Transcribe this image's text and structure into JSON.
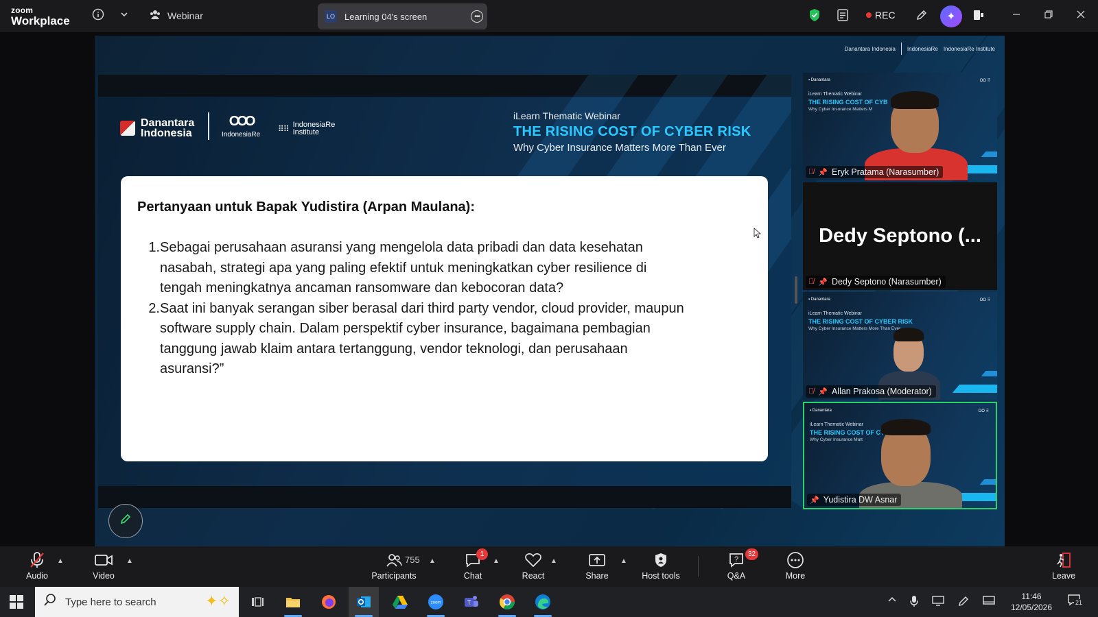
{
  "window": {
    "brand_top": "zoom",
    "brand_bottom": "Workplace",
    "meeting_type": "Webinar",
    "shared_screen_label": "Learning 04's screen",
    "shared_screen_initials": "LO",
    "rec_label": "REC"
  },
  "slide": {
    "logo_danantara": "Danantara Indonesia",
    "logo_indonesiare": "IndonesiaRe",
    "logo_institute": "IndonesiaRe Institute",
    "webinar_label": "iLearn Thematic Webinar",
    "title": "THE RISING COST OF CYBER RISK",
    "tagline": "Why Cyber Insurance Matters More Than Ever",
    "question_heading": "Pertanyaan untuk Bapak Yudistira (Arpan Maulana):",
    "questions": [
      {
        "num": "1.",
        "lines": [
          "Sebagai perusahaan asuransi yang mengelola data pribadi dan data kesehatan",
          "nasabah, strategi apa yang paling efektif untuk meningkatkan cyber resilience di",
          "tengah meningkatnya ancaman ransomware dan kebocoran data?"
        ]
      },
      {
        "num": "2.",
        "lines": [
          "Saat ini banyak serangan siber berasal dari third party vendor, cloud provider, maupun",
          "software supply chain. Dalam perspektif cyber insurance, bagaimana pembagian",
          "tanggung jawab klaim antara tertanggung, vendor teknologi, dan perusahaan",
          "asuransi?”"
        ]
      }
    ]
  },
  "gallery": [
    {
      "name": "Eryk Pratama (Narasumber)",
      "muted": true,
      "video": true
    },
    {
      "name": "Dedy Septono (Narasumber)",
      "display_name": "Dedy Septono (...",
      "muted": true,
      "video": false
    },
    {
      "name": "Allan Prakosa (Moderator)",
      "muted": true,
      "video": true
    },
    {
      "name": "Yudistira DW Asnar",
      "muted": false,
      "video": true,
      "active_speaker": true
    }
  ],
  "toolbar": {
    "audio": "Audio",
    "video": "Video",
    "participants": "Participants",
    "participant_count": "755",
    "chat": "Chat",
    "chat_badge": "1",
    "react": "React",
    "share": "Share",
    "host_tools": "Host tools",
    "qa": "Q&A",
    "qa_badge": "32",
    "more": "More",
    "leave": "Leave"
  },
  "taskbar": {
    "search_placeholder": "Type here to search",
    "time": "11:46",
    "date": "12/05/2026",
    "notification_count": "21"
  },
  "colors": {
    "accent_cyan": "#29c8ff",
    "active_speaker_border": "#2ad06a",
    "rec_dot": "#e53935",
    "badge_red": "#e5383b"
  }
}
